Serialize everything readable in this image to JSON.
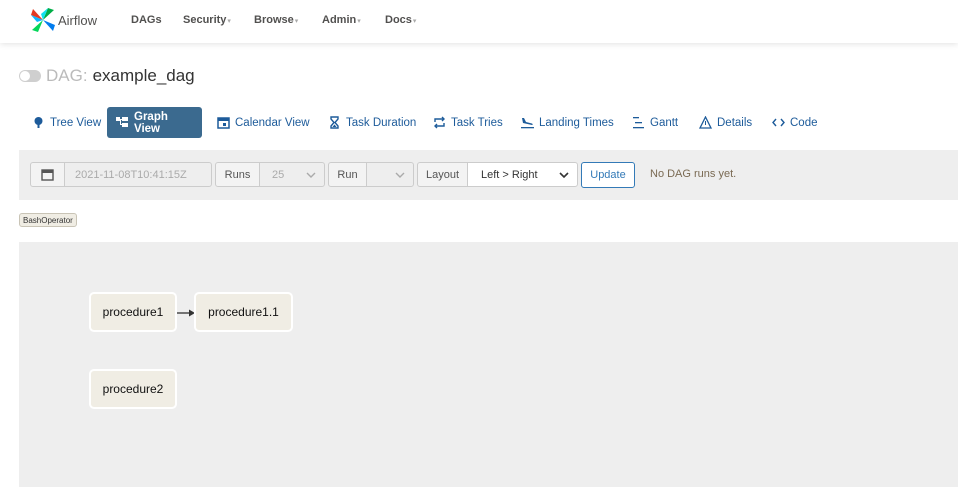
{
  "navbar": {
    "brand": "Airflow",
    "items": [
      {
        "label": "DAGs",
        "dropdown": false
      },
      {
        "label": "Security",
        "dropdown": true
      },
      {
        "label": "Browse",
        "dropdown": true
      },
      {
        "label": "Admin",
        "dropdown": true
      },
      {
        "label": "Docs",
        "dropdown": true
      }
    ],
    "caret": "▾"
  },
  "title": {
    "prefix": "DAG:",
    "dag_id": "example_dag",
    "paused_toggle": "off"
  },
  "tabs": [
    {
      "label": "Tree View",
      "icon": "tree-icon",
      "active": false
    },
    {
      "label": "Graph View",
      "icon": "graph-icon",
      "active": true
    },
    {
      "label": "Calendar View",
      "icon": "calendar-icon",
      "active": false
    },
    {
      "label": "Task Duration",
      "icon": "hourglass-icon",
      "active": false
    },
    {
      "label": "Task Tries",
      "icon": "repeat-icon",
      "active": false
    },
    {
      "label": "Landing Times",
      "icon": "plane-landing-icon",
      "active": false
    },
    {
      "label": "Gantt",
      "icon": "gantt-icon",
      "active": false
    },
    {
      "label": "Details",
      "icon": "warning-triangle-icon",
      "active": false
    },
    {
      "label": "Code",
      "icon": "code-icon",
      "active": false
    }
  ],
  "controls": {
    "datetime_value": "2021-11-08T10:41:15Z",
    "runs_label": "Runs",
    "runs_value": "25",
    "run_label": "Run",
    "run_value": "",
    "layout_label": "Layout",
    "layout_value": "Left > Right",
    "update_label": "Update",
    "status_text": "No DAG runs yet."
  },
  "legend": {
    "operators": [
      "BashOperator"
    ]
  },
  "graph": {
    "nodes": [
      "procedure1",
      "procedure1.1",
      "procedure2"
    ],
    "edges": [
      [
        "procedure1",
        "procedure1.1"
      ]
    ]
  },
  "colors": {
    "active_tab_bg": "#3b6a8f",
    "link": "#1d5b9a",
    "node_fill": "#f0ede4",
    "panel_bg": "#eeeeee"
  }
}
